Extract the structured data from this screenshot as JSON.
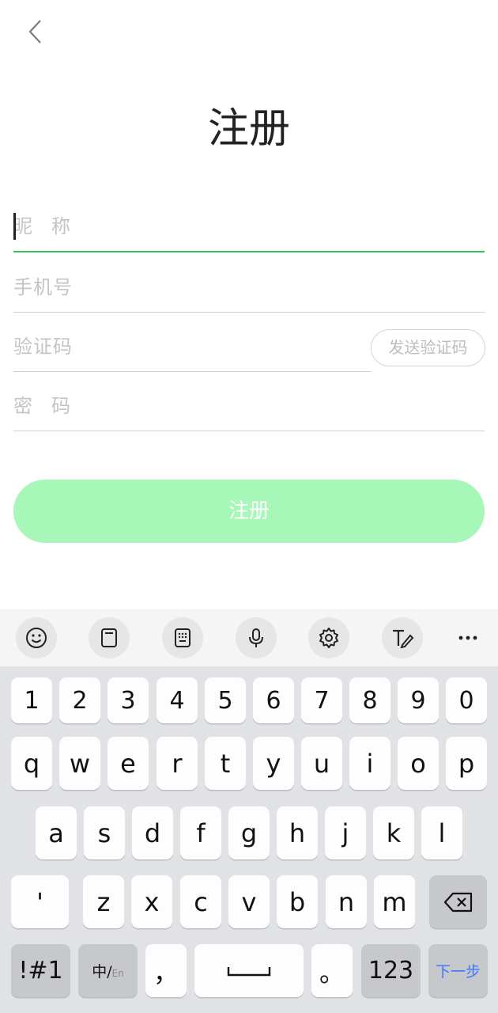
{
  "header": {
    "title": "注册"
  },
  "form": {
    "nickname_placeholder": "昵称",
    "phone_placeholder": "手机号",
    "code_placeholder": "验证码",
    "password_placeholder": "密码",
    "send_code_label": "发送验证码",
    "submit_label": "注册"
  },
  "keyboard": {
    "digits": [
      "1",
      "2",
      "3",
      "4",
      "5",
      "6",
      "7",
      "8",
      "9",
      "0"
    ],
    "row1": [
      "q",
      "w",
      "e",
      "r",
      "t",
      "y",
      "u",
      "i",
      "o",
      "p"
    ],
    "row2": [
      "a",
      "s",
      "d",
      "f",
      "g",
      "h",
      "j",
      "k",
      "l"
    ],
    "row3": [
      "z",
      "x",
      "c",
      "v",
      "b",
      "n",
      "m"
    ],
    "apostrophe": "'",
    "symbols_label": "!#1",
    "lang_zh": "中/",
    "lang_en": "En",
    "comma": "，",
    "period": "。",
    "numbers_label": "123",
    "next_label": "下一步"
  },
  "colors": {
    "accent": "#3ac25a",
    "button_disabled": "#a6f7b8",
    "next_key": "#3b76ff"
  }
}
